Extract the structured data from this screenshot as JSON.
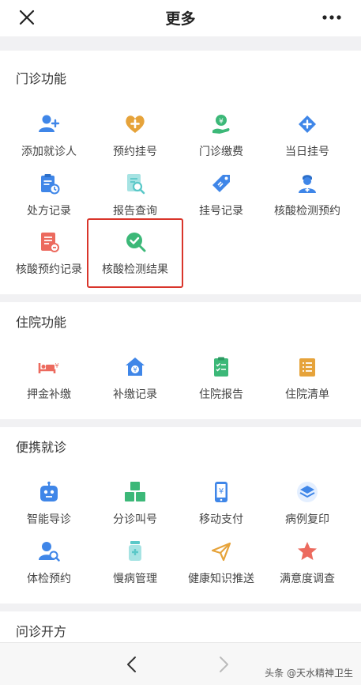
{
  "header": {
    "title": "更多",
    "close_icon": "close-icon",
    "more_icon": "more-dots-icon"
  },
  "sections": {
    "outpatient": {
      "title": "门诊功能",
      "items": [
        {
          "label": "添加就诊人",
          "icon": "add-user-icon",
          "color": "#3f86e8"
        },
        {
          "label": "预约挂号",
          "icon": "heart-plus-icon",
          "color": "#e6a33a"
        },
        {
          "label": "门诊缴费",
          "icon": "payment-hand-icon",
          "color": "#3cb878"
        },
        {
          "label": "当日挂号",
          "icon": "diamond-plus-icon",
          "color": "#3f86e8"
        },
        {
          "label": "处方记录",
          "icon": "clipboard-clock-icon",
          "color": "#3f86e8"
        },
        {
          "label": "报告查询",
          "icon": "report-search-icon",
          "color": "#5ac8c8"
        },
        {
          "label": "挂号记录",
          "icon": "tag-icon",
          "color": "#3f86e8"
        },
        {
          "label": "核酸检测预约",
          "icon": "doctor-icon",
          "color": "#3f86e8"
        },
        {
          "label": "核酸预约记录",
          "icon": "record-doc-icon",
          "color": "#ec6a5e"
        },
        {
          "label": "核酸检测结果",
          "icon": "check-search-icon",
          "color": "#3cb878"
        }
      ]
    },
    "inpatient": {
      "title": "住院功能",
      "items": [
        {
          "label": "押金补缴",
          "icon": "bed-money-icon",
          "color": "#ec6a5e"
        },
        {
          "label": "补缴记录",
          "icon": "house-money-icon",
          "color": "#3f86e8"
        },
        {
          "label": "住院报告",
          "icon": "checklist-icon",
          "color": "#3cb878"
        },
        {
          "label": "住院清单",
          "icon": "list-doc-icon",
          "color": "#e6a33a"
        }
      ]
    },
    "convenience": {
      "title": "便携就诊",
      "items": [
        {
          "label": "智能导诊",
          "icon": "robot-icon",
          "color": "#3f86e8"
        },
        {
          "label": "分诊叫号",
          "icon": "blocks-icon",
          "color": "#3cb878"
        },
        {
          "label": "移动支付",
          "icon": "phone-yen-icon",
          "color": "#3f86e8"
        },
        {
          "label": "病例复印",
          "icon": "layers-icon",
          "color": "#3f86e8"
        },
        {
          "label": "体检预约",
          "icon": "person-search-icon",
          "color": "#3f86e8"
        },
        {
          "label": "慢病管理",
          "icon": "medicine-bottle-icon",
          "color": "#5ac8c8"
        },
        {
          "label": "健康知识推送",
          "icon": "paper-plane-icon",
          "color": "#e6a33a"
        },
        {
          "label": "满意度调查",
          "icon": "star-icon",
          "color": "#ec6a5e"
        }
      ]
    },
    "consult": {
      "title": "问诊开方"
    }
  },
  "bottom": {
    "back_icon": "chevron-left-icon",
    "forward_icon": "chevron-right-icon"
  },
  "watermark": "头条 @天水精神卫生"
}
